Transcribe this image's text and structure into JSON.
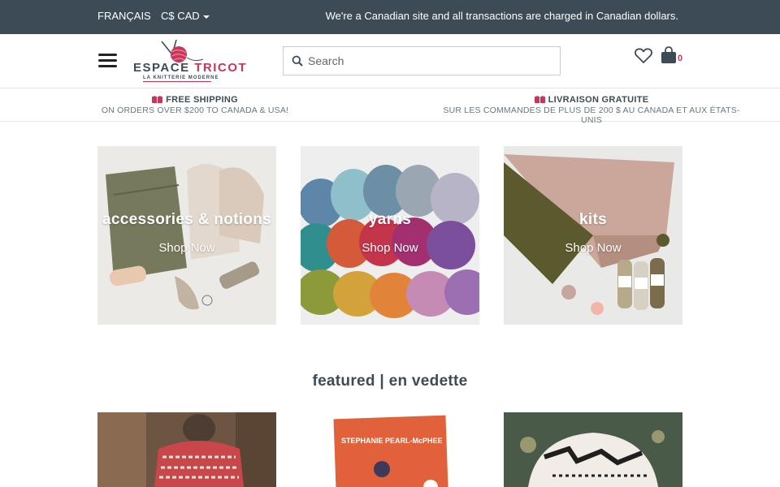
{
  "topbar": {
    "language": "FRANÇAIS",
    "currency": "C$ CAD",
    "notice": "We're a Canadian site and all transactions are charged in Canadian dollars."
  },
  "header": {
    "logo": {
      "brand_part1": "ESPACE ",
      "brand_part2": "TRICOT",
      "tagline": "LA KNITTERIE MODERNE"
    },
    "search": {
      "placeholder": "Search",
      "value": ""
    },
    "cart_count": "0",
    "icons": [
      "menu-icon",
      "search-icon",
      "heart-icon",
      "shopping-bag-icon",
      "gift-icon"
    ]
  },
  "promo": {
    "left": {
      "title": "FREE SHIPPING",
      "sub": "ON ORDERS OVER $200 TO CANADA & USA!"
    },
    "right": {
      "title": "LIVRAISON GRATUITE",
      "sub": "SUR LES COMMANDES DE PLUS DE 200 $ AU CANADA ET AUX ÉTATS-UNIS"
    }
  },
  "categories": [
    {
      "title": "accessories & notions",
      "link": "Shop Now"
    },
    {
      "title": "yarns",
      "link": "Shop Now"
    },
    {
      "title": "kits",
      "link": "Shop Now"
    }
  ],
  "featured": {
    "title": "featured | en vedette"
  },
  "colors": {
    "topbar": "#3d4b56",
    "accent": "#c9365a",
    "text": "#3d4b56"
  }
}
